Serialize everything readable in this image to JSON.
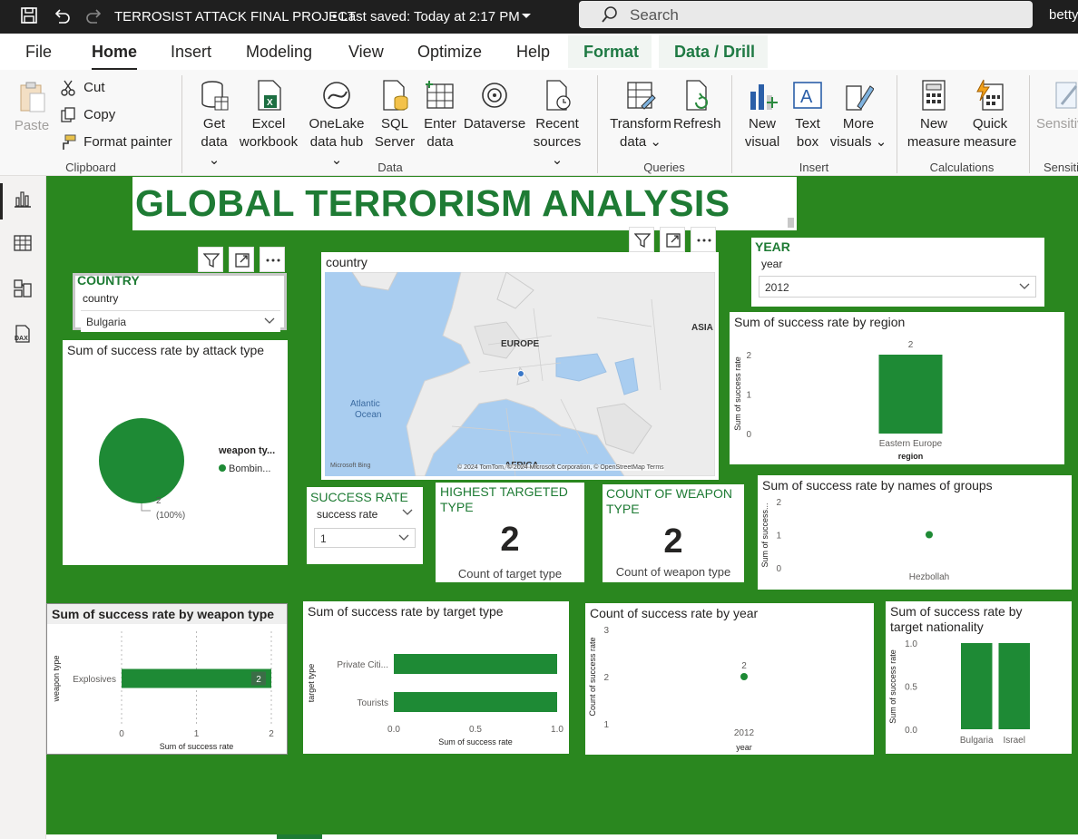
{
  "titlebar": {
    "document": "TERROSIST ATTACK FINAL PROJECT",
    "saved": "• Last saved: Today at 2:17 PM",
    "search_placeholder": "Search",
    "user": "betty"
  },
  "menu": [
    "File",
    "Home",
    "Insert",
    "Modeling",
    "View",
    "Optimize",
    "Help",
    "Format",
    "Data / Drill"
  ],
  "ribbon": {
    "clipboard": {
      "paste": "Paste",
      "cut": "Cut",
      "copy": "Copy",
      "format_painter": "Format painter",
      "label": "Clipboard"
    },
    "data": {
      "get_data": [
        "Get",
        "data"
      ],
      "excel": [
        "Excel",
        "workbook"
      ],
      "onelake": [
        "OneLake",
        "data hub"
      ],
      "sql": [
        "SQL",
        "Server"
      ],
      "enter": [
        "Enter",
        "data"
      ],
      "dataverse": "Dataverse",
      "recent": [
        "Recent",
        "sources"
      ],
      "label": "Data"
    },
    "queries": {
      "transform": [
        "Transform",
        "data"
      ],
      "refresh": "Refresh",
      "label": "Queries"
    },
    "insert": {
      "new_visual": [
        "New",
        "visual"
      ],
      "text_box": [
        "Text",
        "box"
      ],
      "more_visuals": [
        "More",
        "visuals"
      ],
      "label": "Insert"
    },
    "calculations": {
      "new_measure": [
        "New",
        "measure"
      ],
      "quick_measure": [
        "Quick",
        "measure"
      ],
      "label": "Calculations"
    },
    "sensitivity": {
      "btn": "Sensitiv",
      "label": "Sensitiv"
    }
  },
  "report": {
    "title": "GLOBAL TERRORISM ANALYSIS",
    "country_slicer": {
      "header": "COUNTRY",
      "field": "country",
      "value": "Bulgaria"
    },
    "year_slicer": {
      "header": "YEAR",
      "field": "year",
      "value": "2012"
    },
    "success_slicer": {
      "header": "SUCCESS RATE",
      "field": "success rate",
      "value": "1"
    },
    "map": {
      "title": "country",
      "labels": {
        "europe": "EUROPE",
        "asia": "ASIA",
        "atlantic": "Atlantic",
        "ocean": "Ocean",
        "africa": "AFRICA"
      },
      "brand": "Microsoft Bing",
      "copyright": "© 2024 TomTom, © 2024 Microsoft Corporation, © OpenStreetMap  Terms"
    },
    "card_target": {
      "title": "HIGHEST TARGETED TYPE",
      "value": "2",
      "label": "Count of target type"
    },
    "card_weapon": {
      "title": "COUNT OF WEAPON TYPE",
      "value": "2",
      "label": "Count of weapon type"
    }
  },
  "chart_data": [
    {
      "id": "pie_attack",
      "type": "pie",
      "title": "Sum of success rate by attack type",
      "legend_title": "weapon ty...",
      "legend": [
        "Bombin..."
      ],
      "slices": [
        {
          "label": "Bombin...",
          "value": 2
        }
      ],
      "data_label": "2",
      "data_pct": "(100%)",
      "legend_position": "right"
    },
    {
      "id": "bar_region",
      "type": "bar",
      "title": "Sum of success rate by region",
      "categories": [
        "Eastern Europe"
      ],
      "values": [
        2
      ],
      "data_labels": [
        "2"
      ],
      "xlabel": "region",
      "ylabel": "Sum of success rate",
      "ylim": [
        0,
        2
      ],
      "yticks": [
        "0",
        "1",
        "2"
      ]
    },
    {
      "id": "scatter_groups",
      "type": "scatter",
      "title": "Sum of success rate by names of groups",
      "categories": [
        "Hezbollah"
      ],
      "values": [
        1
      ],
      "ylabel": "Sum of success...",
      "ylim": [
        0,
        2
      ],
      "yticks": [
        "0",
        "1",
        "2"
      ]
    },
    {
      "id": "hbar_weapon",
      "type": "bar",
      "orientation": "horizontal",
      "title": "Sum of success rate by weapon type",
      "categories": [
        "Explosives"
      ],
      "values": [
        2
      ],
      "data_labels": [
        "2"
      ],
      "xlabel": "Sum of success rate",
      "ylabel": "weapon type",
      "xlim": [
        0,
        2
      ],
      "xticks": [
        "0",
        "1",
        "2"
      ]
    },
    {
      "id": "hbar_target",
      "type": "bar",
      "orientation": "horizontal",
      "title": "Sum of success rate by target type",
      "categories": [
        "Private Citi...",
        "Tourists"
      ],
      "values": [
        1,
        1
      ],
      "xlabel": "Sum of success rate",
      "ylabel": "target type",
      "xlim": [
        0,
        1
      ],
      "xticks": [
        "0.0",
        "0.5",
        "1.0"
      ]
    },
    {
      "id": "line_year",
      "type": "line",
      "title": "Count of success rate by year",
      "categories": [
        "2012"
      ],
      "values": [
        2
      ],
      "data_labels": [
        "2"
      ],
      "xlabel": "year",
      "ylabel": "Count of success rate",
      "ylim": [
        1,
        3
      ],
      "yticks": [
        "1",
        "2",
        "3"
      ]
    },
    {
      "id": "bar_nationality",
      "type": "bar",
      "title": "Sum of success rate by target nationality",
      "title_lines": [
        "Sum of success rate by",
        "target nationality"
      ],
      "categories": [
        "Bulgaria",
        "Israel"
      ],
      "values": [
        1,
        1
      ],
      "ylabel": "Sum of success rate",
      "ylim": [
        0,
        1
      ],
      "yticks": [
        "0.0",
        "0.5",
        "1.0"
      ]
    }
  ],
  "colors": {
    "canvas": "#2a871f",
    "accent": "#1e8a35",
    "title_green": "#1e7b34",
    "topbar": "#1f1f1f"
  }
}
